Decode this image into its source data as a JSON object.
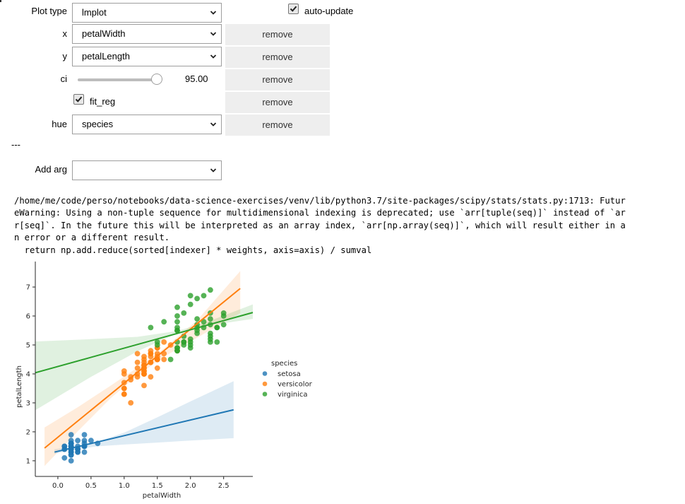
{
  "controls": {
    "plot_type": {
      "label": "Plot type",
      "value": "lmplot"
    },
    "auto_update": {
      "label": "auto-update",
      "checked": true
    },
    "args": [
      {
        "name": "x",
        "label": "x",
        "kind": "select",
        "value": "petalWidth",
        "remove_label": "remove"
      },
      {
        "name": "y",
        "label": "y",
        "kind": "select",
        "value": "petalLength",
        "remove_label": "remove"
      },
      {
        "name": "ci",
        "label": "ci",
        "kind": "slider",
        "value": 95.0,
        "value_text": "95.00",
        "min": 0,
        "max": 100,
        "remove_label": "remove"
      },
      {
        "name": "fit_reg",
        "label": "fit_reg",
        "kind": "checkbox",
        "checked": true,
        "remove_label": "remove"
      },
      {
        "name": "hue",
        "label": "hue",
        "kind": "select",
        "value": "species",
        "remove_label": "remove"
      }
    ],
    "separator": "---",
    "add_arg": {
      "label": "Add arg",
      "value": ""
    }
  },
  "stderr": {
    "lines": [
      "/home/me/code/perso/notebooks/data-science-exercises/venv/lib/python3.7/site-packages/scipy/stats/stats.py:1713: Futur",
      "eWarning: Using a non-tuple sequence for multidimensional indexing is deprecated; use `arr[tuple(seq)]` instead of `ar",
      "r[seq]`. In the future this will be interpreted as an array index, `arr[np.array(seq)]`, which will result either in a",
      "n error or a different result.",
      "  return np.add.reduce(sorted[indexer] * weights, axis=axis) / sumval"
    ]
  },
  "chart_data": {
    "type": "scatter",
    "title": "",
    "xlabel": "petalWidth",
    "ylabel": "petalLength",
    "xlim": [
      -0.34,
      2.94
    ],
    "ylim": [
      0.46,
      7.88
    ],
    "xticks": [
      0.0,
      0.5,
      1.0,
      1.5,
      2.0,
      2.5
    ],
    "xtick_labels": [
      "0.0",
      "0.5",
      "1.0",
      "1.5",
      "2.0",
      "2.5"
    ],
    "yticks": [
      1,
      2,
      3,
      4,
      5,
      6,
      7
    ],
    "ytick_labels": [
      "1",
      "2",
      "3",
      "4",
      "5",
      "6",
      "7"
    ],
    "grid": false,
    "legend": {
      "title": "species",
      "placement": "right"
    },
    "series": [
      {
        "name": "setosa",
        "color": "#1f77b4",
        "x": [
          0.2,
          0.2,
          0.2,
          0.2,
          0.2,
          0.4,
          0.3,
          0.2,
          0.2,
          0.1,
          0.2,
          0.2,
          0.1,
          0.1,
          0.2,
          0.4,
          0.4,
          0.3,
          0.3,
          0.3,
          0.2,
          0.4,
          0.2,
          0.5,
          0.2,
          0.2,
          0.4,
          0.2,
          0.2,
          0.2,
          0.2,
          0.4,
          0.1,
          0.2,
          0.2,
          0.2,
          0.2,
          0.1,
          0.2,
          0.2,
          0.3,
          0.3,
          0.2,
          0.6,
          0.4,
          0.3,
          0.2,
          0.2,
          0.2,
          0.2
        ],
        "y": [
          1.4,
          1.4,
          1.3,
          1.5,
          1.4,
          1.7,
          1.4,
          1.5,
          1.4,
          1.5,
          1.5,
          1.6,
          1.4,
          1.1,
          1.2,
          1.5,
          1.3,
          1.4,
          1.7,
          1.5,
          1.7,
          1.5,
          1.0,
          1.7,
          1.9,
          1.6,
          1.6,
          1.5,
          1.4,
          1.6,
          1.6,
          1.5,
          1.5,
          1.4,
          1.5,
          1.2,
          1.3,
          1.4,
          1.3,
          1.5,
          1.3,
          1.3,
          1.3,
          1.6,
          1.9,
          1.4,
          1.6,
          1.4,
          1.5,
          1.4
        ],
        "fit": {
          "x0": -0.05,
          "y0": 1.3,
          "x1": 2.65,
          "y1": 2.76
        },
        "ci_band": {
          "x": [
            -0.05,
            0.3,
            0.6,
            1.0,
            1.5,
            2.0,
            2.65
          ],
          "lower": [
            1.24,
            1.41,
            1.5,
            1.56,
            1.63,
            1.7,
            1.78
          ],
          "upper": [
            1.4,
            1.5,
            1.66,
            1.97,
            2.5,
            3.05,
            3.75
          ]
        }
      },
      {
        "name": "versicolor",
        "color": "#ff7f0e",
        "x": [
          1.4,
          1.5,
          1.5,
          1.3,
          1.5,
          1.3,
          1.6,
          1.0,
          1.3,
          1.4,
          1.0,
          1.5,
          1.0,
          1.4,
          1.3,
          1.4,
          1.5,
          1.0,
          1.5,
          1.1,
          1.8,
          1.3,
          1.5,
          1.2,
          1.3,
          1.4,
          1.4,
          1.7,
          1.5,
          1.0,
          1.1,
          1.0,
          1.2,
          1.6,
          1.5,
          1.6,
          1.5,
          1.3,
          1.3,
          1.3,
          1.2,
          1.4,
          1.2,
          1.0,
          1.3,
          1.2,
          1.3,
          1.3,
          1.1,
          1.3
        ],
        "y": [
          4.7,
          4.5,
          4.9,
          4.0,
          4.6,
          4.5,
          4.7,
          3.3,
          4.6,
          3.9,
          3.5,
          4.2,
          4.0,
          4.7,
          3.6,
          4.4,
          4.5,
          4.1,
          4.5,
          3.9,
          4.8,
          4.0,
          4.9,
          4.7,
          4.3,
          4.4,
          4.8,
          5.0,
          4.5,
          3.5,
          3.8,
          3.7,
          3.9,
          5.1,
          4.5,
          4.5,
          4.7,
          4.4,
          4.1,
          4.0,
          4.4,
          4.6,
          4.0,
          3.3,
          4.2,
          4.2,
          4.2,
          4.3,
          3.0,
          4.1
        ],
        "fit": {
          "x0": -0.2,
          "y0": 1.44,
          "x1": 2.75,
          "y1": 6.95
        },
        "ci_band": {
          "x": [
            -0.2,
            0.3,
            0.8,
            1.2,
            1.6,
            2.1,
            2.75
          ],
          "lower": [
            0.82,
            2.02,
            3.17,
            3.95,
            4.59,
            5.25,
            6.1
          ],
          "upper": [
            2.15,
            2.85,
            3.6,
            4.22,
            4.88,
            5.85,
            7.55
          ]
        }
      },
      {
        "name": "virginica",
        "color": "#2ca02c",
        "x": [
          2.5,
          1.9,
          2.1,
          1.8,
          2.2,
          2.1,
          1.7,
          1.8,
          1.8,
          2.5,
          2.0,
          1.9,
          2.1,
          2.0,
          2.4,
          2.3,
          1.8,
          2.2,
          2.3,
          1.5,
          2.3,
          2.0,
          2.0,
          1.8,
          2.1,
          1.8,
          1.8,
          1.8,
          2.1,
          1.6,
          1.9,
          2.0,
          2.2,
          1.5,
          1.4,
          2.3,
          2.4,
          1.8,
          1.8,
          2.1,
          2.4,
          2.3,
          1.9,
          2.3,
          2.5,
          2.3,
          1.9,
          2.0,
          2.3,
          1.8
        ],
        "y": [
          6.0,
          5.1,
          5.9,
          5.6,
          5.8,
          6.6,
          4.5,
          6.3,
          5.8,
          6.1,
          5.1,
          5.3,
          5.5,
          5.0,
          5.1,
          5.3,
          5.5,
          6.7,
          6.9,
          5.0,
          5.7,
          4.9,
          6.7,
          4.9,
          5.7,
          6.0,
          4.8,
          4.9,
          5.6,
          5.8,
          6.1,
          6.4,
          5.6,
          5.1,
          5.6,
          6.1,
          5.6,
          5.5,
          4.8,
          5.4,
          5.6,
          5.1,
          5.1,
          5.9,
          5.7,
          5.2,
          5.0,
          5.2,
          5.4,
          5.1
        ],
        "fit": {
          "x0": -0.34,
          "y0": 4.04,
          "x1": 2.94,
          "y1": 6.12
        },
        "ci_band": {
          "x": [
            -0.34,
            0.5,
            1.2,
            1.8,
            2.2,
            2.94
          ],
          "lower": [
            2.75,
            3.9,
            4.78,
            5.4,
            5.65,
            5.9
          ],
          "upper": [
            5.12,
            5.2,
            5.28,
            5.48,
            5.75,
            6.4
          ]
        }
      }
    ]
  }
}
